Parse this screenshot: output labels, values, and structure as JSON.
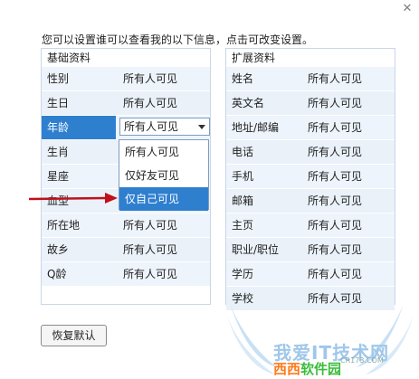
{
  "intro": "您可以设置谁可以查看我的以下信息，点击可改变设置。",
  "basic_panel": {
    "title": "基础资料",
    "rows": [
      {
        "label": "性别",
        "value": "所有人可见"
      },
      {
        "label": "生日",
        "value": "所有人可见"
      },
      {
        "label": "年龄",
        "value": "所有人可见"
      },
      {
        "label": "生肖",
        "value": ""
      },
      {
        "label": "星座",
        "value": ""
      },
      {
        "label": "血型",
        "value": ""
      },
      {
        "label": "所在地",
        "value": "所有人可见"
      },
      {
        "label": "故乡",
        "value": "所有人可见"
      },
      {
        "label": "Q龄",
        "value": "所有人可见"
      }
    ]
  },
  "ext_panel": {
    "title": "扩展资料",
    "rows": [
      {
        "label": "姓名",
        "value": "所有人可见"
      },
      {
        "label": "英文名",
        "value": "所有人可见"
      },
      {
        "label": "地址/邮编",
        "value": "所有人可见"
      },
      {
        "label": "电话",
        "value": "所有人可见"
      },
      {
        "label": "手机",
        "value": "所有人可见"
      },
      {
        "label": "邮箱",
        "value": "所有人可见"
      },
      {
        "label": "主页",
        "value": "所有人可见"
      },
      {
        "label": "职业/职位",
        "value": "所有人可见"
      },
      {
        "label": "学历",
        "value": "所有人可见"
      },
      {
        "label": "学校",
        "value": "所有人可见"
      }
    ]
  },
  "dropdown": {
    "selected": "所有人可见",
    "options": [
      "所有人可见",
      "仅好友可见",
      "仅自己可见"
    ],
    "highlighted_index": 2
  },
  "restore_button": "恢复默认",
  "watermark": {
    "line1": "我爱IT技术网",
    "brand_a": "西西",
    "brand_b": "软件园",
    "url": "CR173.COM"
  },
  "colors": {
    "selection": "#2f7fcf",
    "row_bg": "#eaf1f9",
    "arrow": "#c0101a"
  },
  "icons": {
    "close": "close-icon",
    "caret": "chevron-down-icon",
    "pointer": "red-arrow-icon"
  }
}
